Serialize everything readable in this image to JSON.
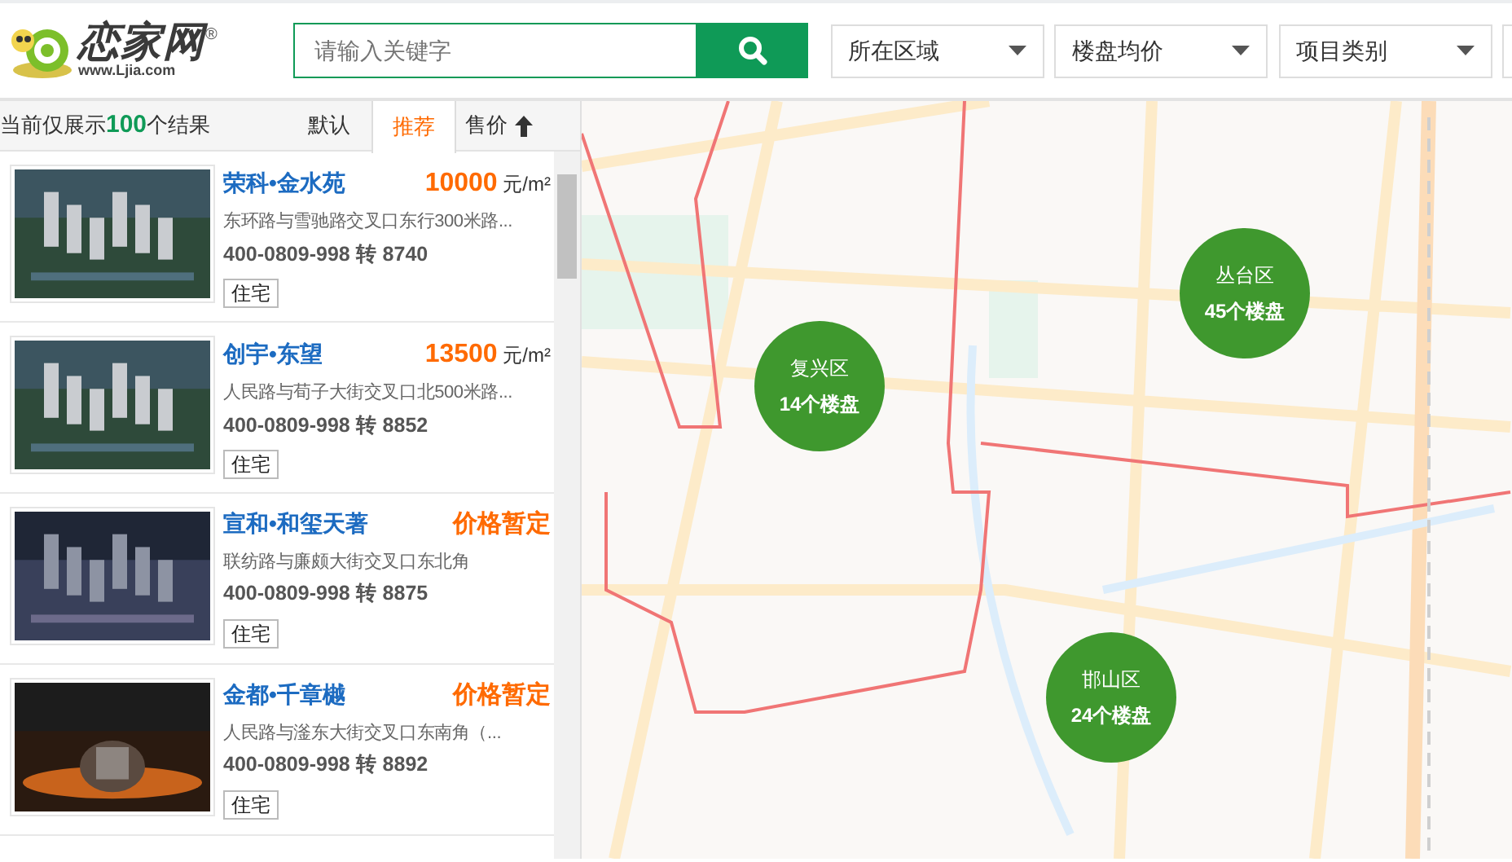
{
  "logo": {
    "name": "恋家网",
    "registered": "®",
    "domain": "www.Ljia.com"
  },
  "search": {
    "placeholder": "请输入关键字"
  },
  "filters": [
    {
      "label": "所在区域"
    },
    {
      "label": "楼盘均价"
    },
    {
      "label": "项目类别"
    }
  ],
  "results": {
    "prefix": "当前仅展示",
    "count": "100",
    "suffix": "个结果"
  },
  "sort_tabs": [
    {
      "label": "默认",
      "selected": false,
      "kind": "plain"
    },
    {
      "label": "推荐",
      "selected": true,
      "kind": "plain"
    },
    {
      "label": "售价",
      "selected": false,
      "kind": "arrow"
    }
  ],
  "listings": [
    {
      "name": "荣科•金水苑",
      "price": "10000",
      "unit": "元/m²",
      "address": "东环路与雪驰路交叉口东行300米路...",
      "phone": "400-0809-998 转 8740",
      "tag": "住宅",
      "kind": "picture"
    },
    {
      "name": "创宇•东望",
      "price": "13500",
      "unit": "元/m²",
      "address": "人民路与荀子大街交叉口北500米路...",
      "phone": "400-0809-998 转 8852",
      "tag": "住宅",
      "kind": "picture"
    },
    {
      "name": "宣和•和玺天著",
      "price": "价格暂定",
      "address": "联纺路与廉颇大街交叉口东北角",
      "phone": "400-0809-998 转 8875",
      "tag": "住宅",
      "kind": "picture"
    },
    {
      "name": "金都•千章樾",
      "price": "价格暂定",
      "address": "人民路与滏东大街交叉口东南角（...",
      "phone": "400-0809-998 转 8892",
      "tag": "住宅",
      "kind": "picture"
    }
  ],
  "map": {
    "kind": "picture",
    "clusters": [
      {
        "district": "复兴区",
        "count": "14个楼盘"
      },
      {
        "district": "丛台区",
        "count": "45个楼盘"
      },
      {
        "district": "邯山区",
        "count": "24个楼盘"
      }
    ]
  }
}
